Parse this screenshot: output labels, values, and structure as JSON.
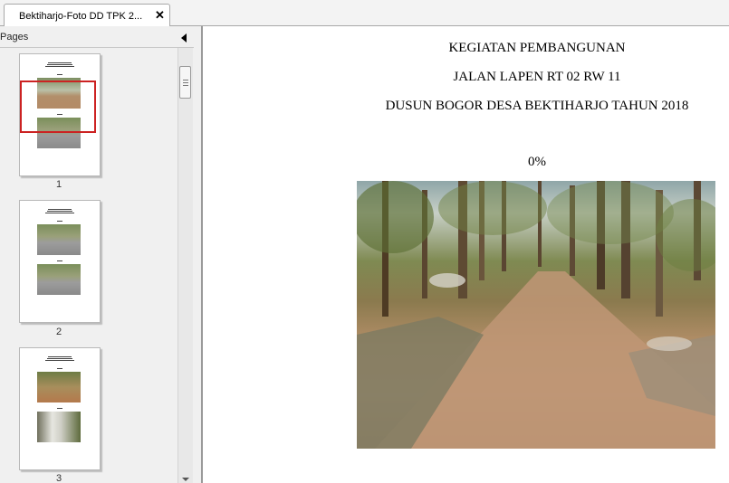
{
  "tab": {
    "title": "Bektiharjo-Foto DD TPK 2..."
  },
  "sidebar": {
    "title": "Pages",
    "pages": [
      {
        "number": "1"
      },
      {
        "number": "2"
      },
      {
        "number": "3"
      }
    ]
  },
  "document": {
    "lines": [
      "KEGIATAN PEMBANGUNAN",
      "JALAN LAPEN RT 02 RW 11",
      "DUSUN BOGOR DESA BEKTIHARJO TAHUN 2018"
    ],
    "progress_label": "0%"
  },
  "colors": {
    "selection": "#cc2222",
    "sidebar_bg": "#f0f0f0"
  },
  "icons": {
    "close": "close-icon",
    "collapse": "chevron-left-icon"
  }
}
